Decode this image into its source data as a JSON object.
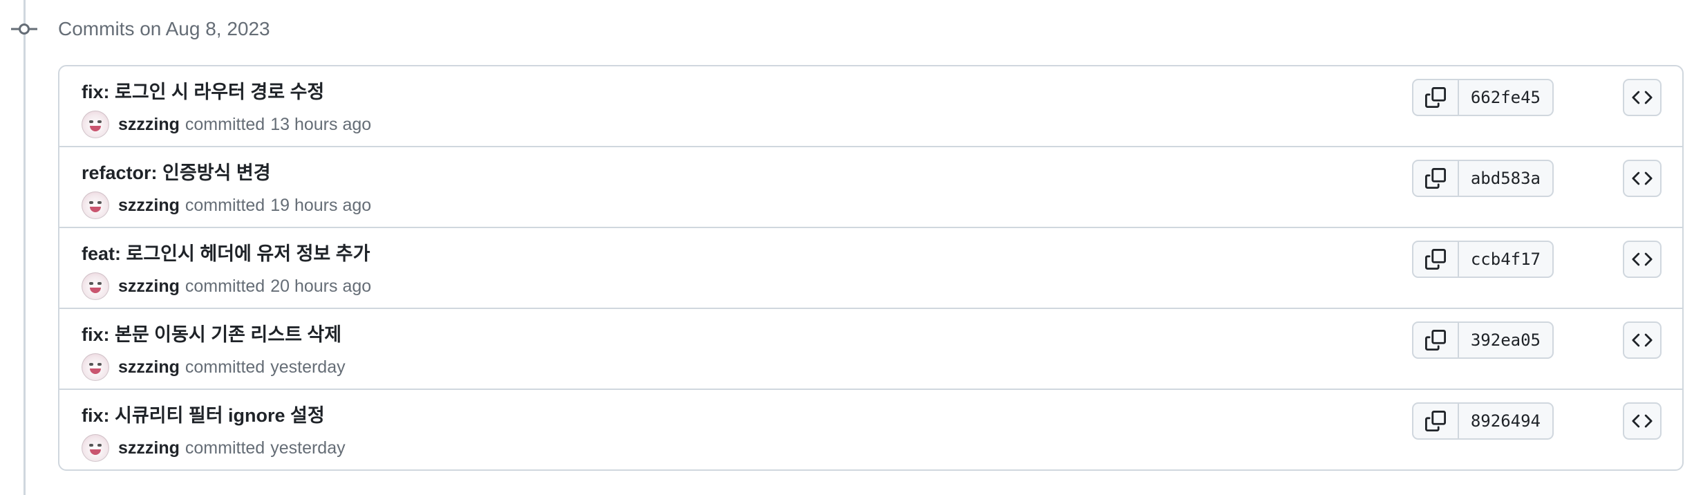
{
  "group": {
    "heading": "Commits on Aug 8, 2023"
  },
  "commits": [
    {
      "title": "fix: 로그인 시 라우터 경로 수정",
      "author": "szzzing",
      "committed": "committed",
      "when": "13 hours ago",
      "sha": "662fe45"
    },
    {
      "title": "refactor: 인증방식 변경",
      "author": "szzzing",
      "committed": "committed",
      "when": "19 hours ago",
      "sha": "abd583a"
    },
    {
      "title": "feat: 로그인시 헤더에 유저 정보 추가",
      "author": "szzzing",
      "committed": "committed",
      "when": "20 hours ago",
      "sha": "ccb4f17"
    },
    {
      "title": "fix: 본문 이동시 기존 리스트 삭제",
      "author": "szzzing",
      "committed": "committed",
      "when": "yesterday",
      "sha": "392ea05"
    },
    {
      "title": "fix: 시큐리티 필터 ignore 설정",
      "author": "szzzing",
      "committed": "committed",
      "when": "yesterday",
      "sha": "8926494"
    }
  ],
  "icons": {
    "timeline": "git-commit-icon",
    "copy": "copy-icon",
    "browse": "code-icon"
  },
  "colors": {
    "text": "#1f2328",
    "muted": "#656d76",
    "border": "#d0d7de",
    "button_bg": "#f6f8fa"
  }
}
